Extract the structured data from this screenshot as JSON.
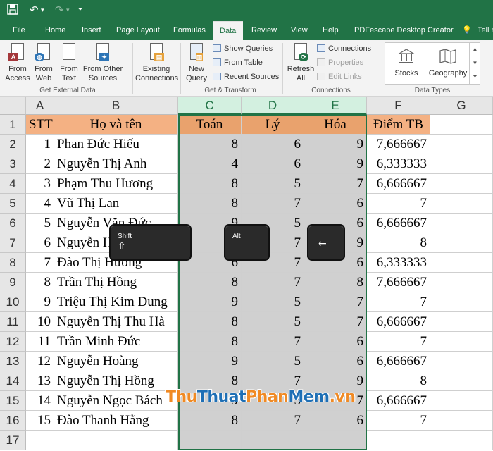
{
  "menu": [
    "File",
    "Home",
    "Insert",
    "Page Layout",
    "Formulas",
    "Data",
    "Review",
    "View",
    "Help",
    "PDFescape Desktop Creator",
    "Tell m"
  ],
  "active_tab": "Data",
  "ribbon": {
    "get_external": {
      "label": "Get External Data",
      "buttons": [
        "From Access",
        "From Web",
        "From Text",
        "From Other Sources"
      ]
    },
    "existing": "Existing Connections",
    "get_transform": {
      "label": "Get & Transform",
      "new_query": "New Query",
      "small": [
        "Show Queries",
        "From Table",
        "Recent Sources"
      ]
    },
    "connections": {
      "label": "Connections",
      "refresh": "Refresh All",
      "small": [
        "Connections",
        "Properties",
        "Edit Links"
      ]
    },
    "data_types": {
      "label": "Data Types",
      "items": [
        "Stocks",
        "Geography"
      ]
    }
  },
  "columns": [
    "A",
    "B",
    "C",
    "D",
    "E",
    "F",
    "G"
  ],
  "headers": [
    "STT",
    "Họ và tên",
    "Toán",
    "Lý",
    "Hóa",
    "Điểm TB"
  ],
  "rows": [
    [
      "1",
      "Phan Đức Hiếu",
      "8",
      "6",
      "9",
      "7,666667"
    ],
    [
      "2",
      "Nguyễn Thị Anh",
      "4",
      "6",
      "9",
      "6,333333"
    ],
    [
      "3",
      "Phạm Thu Hương",
      "8",
      "5",
      "7",
      "6,666667"
    ],
    [
      "4",
      "Vũ Thị Lan",
      "8",
      "7",
      "6",
      "7"
    ],
    [
      "5",
      "Nguyễn Văn Đức",
      "9",
      "5",
      "6",
      "6,666667"
    ],
    [
      "6",
      "Nguyễn H",
      "8",
      "7",
      "9",
      "8"
    ],
    [
      "7",
      "Đào Thị Hương",
      "6",
      "7",
      "6",
      "6,333333"
    ],
    [
      "8",
      "Trần Thị Hồng",
      "8",
      "7",
      "8",
      "7,666667"
    ],
    [
      "9",
      "Triệu Thị Kim Dung",
      "9",
      "5",
      "7",
      "7"
    ],
    [
      "10",
      "Nguyễn Thị Thu Hà",
      "8",
      "5",
      "7",
      "6,666667"
    ],
    [
      "11",
      "Trần Minh Đức",
      "8",
      "7",
      "6",
      "7"
    ],
    [
      "12",
      "Nguyễn Hoàng",
      "9",
      "5",
      "6",
      "6,666667"
    ],
    [
      "13",
      "Nguyễn Thị Hồng",
      "8",
      "7",
      "9",
      "8"
    ],
    [
      "14",
      "Nguyễn Ngọc Bách",
      "9",
      "5",
      "7",
      "6,666667"
    ],
    [
      "15",
      "Đào Thanh Hằng",
      "8",
      "7",
      "6",
      "7"
    ]
  ],
  "keys": {
    "shift": "Shift",
    "alt": "Alt",
    "left_arrow": "←",
    "up_arrow": "⇧"
  },
  "watermark": {
    "a": "Thu",
    "b": "Thuat",
    "c": "Phan",
    "d": "Mem",
    "e": ".vn"
  },
  "colors": {
    "excel_green": "#217346",
    "header_fill": "#f4b183",
    "header_fill_dark": "#e9a26d",
    "selection": "#d0d0d0"
  }
}
